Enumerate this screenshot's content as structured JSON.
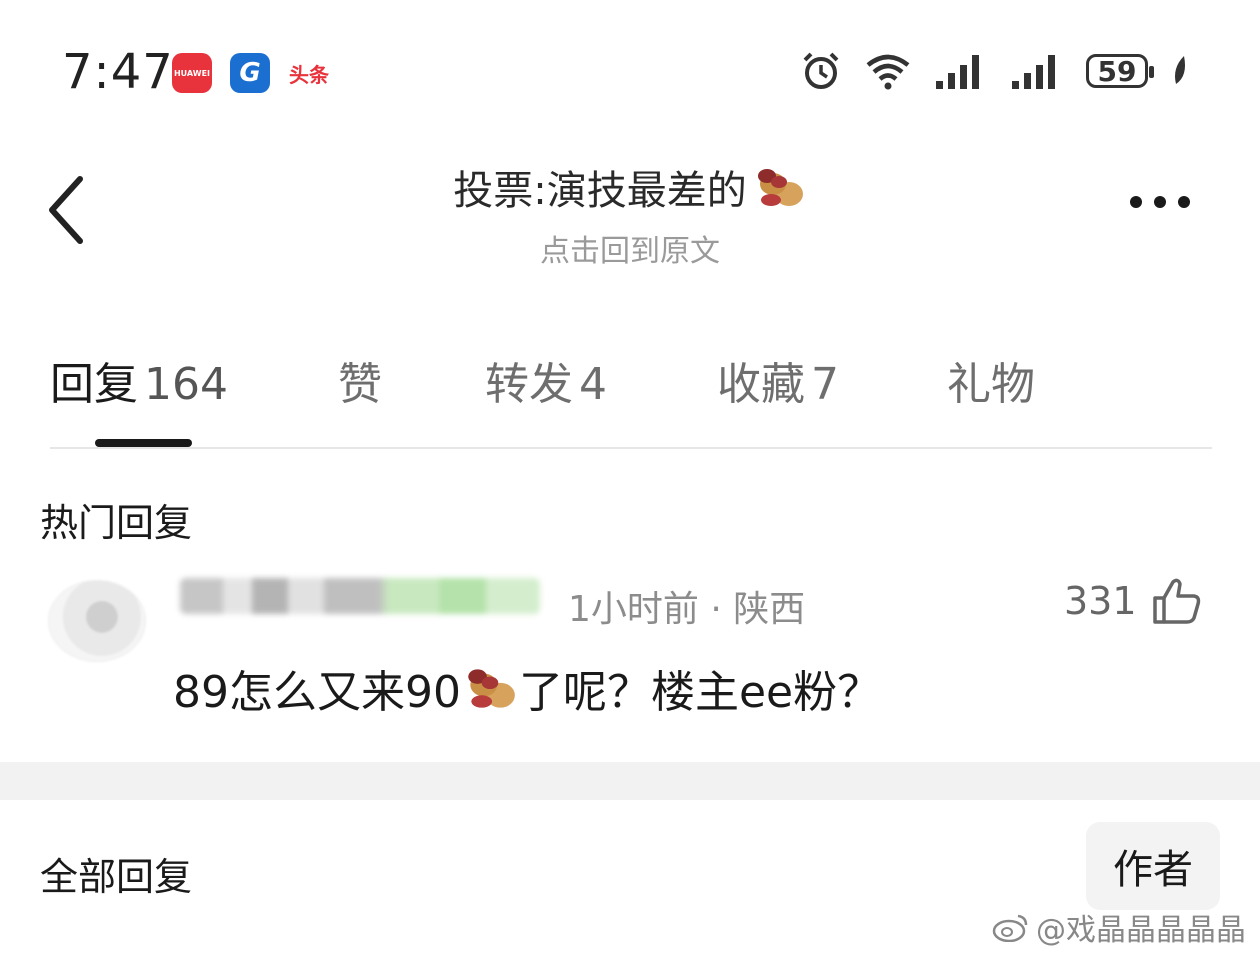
{
  "status_bar": {
    "time": "7:47",
    "apps": [
      {
        "name": "HUAWEI",
        "color": "#e8323c"
      },
      {
        "name": "广发证券",
        "color": "#1a6fd1"
      },
      {
        "name": "头条",
        "color": "#e8323c"
      }
    ],
    "battery": "59"
  },
  "header": {
    "title": "投票:演技最差的",
    "subtitle": "点击回到原文"
  },
  "tabs": [
    {
      "label": "回复",
      "count": "164",
      "active": true
    },
    {
      "label": "赞",
      "count": ""
    },
    {
      "label": "转发",
      "count": "4"
    },
    {
      "label": "收藏",
      "count": "7"
    },
    {
      "label": "礼物",
      "count": ""
    }
  ],
  "hot_section": {
    "title": "热门回复"
  },
  "comment": {
    "meta": "1小时前 · 陕西",
    "likes": "331",
    "text_part1": "89怎么又来90",
    "text_part2": "了呢？楼主ee粉？"
  },
  "all_section": {
    "title": "全部回复",
    "author_button": "作者"
  },
  "watermark": "@戏晶晶晶晶晶"
}
